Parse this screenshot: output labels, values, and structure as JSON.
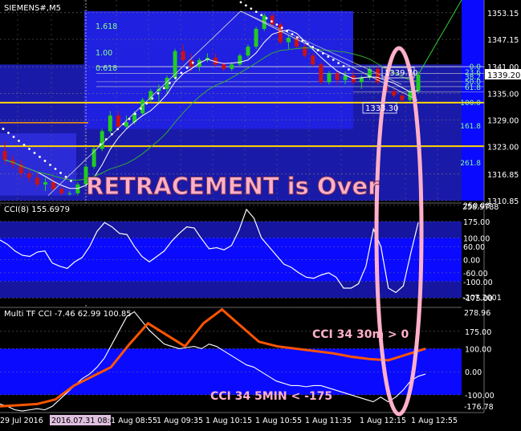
{
  "window": {
    "symbol_label": "SIEMENS#,M5"
  },
  "colors": {
    "bg": "#000000",
    "zone": "#1a1aa8",
    "zone_bright": "#0a0aff",
    "grid": "#555555",
    "candle_up": "#22cc22",
    "candle_down": "#cc1111",
    "ma_fast": "#ffffff",
    "ma_slow": "#33aa33",
    "psar": "#ffffff",
    "level_yellow": "#ffd700",
    "level_orange": "#ff9900",
    "fibo": "#88ff88",
    "pink": "#ffb0c8",
    "cci_line": "#ffffff",
    "cci30": "#ff5500"
  },
  "annotations": {
    "headline": "RETRACEMENT is Over",
    "cci30_note": "CCI 34 30m > 0",
    "cci5_note": "CCI 34 5MIN < -175"
  },
  "price_panel": {
    "last_price": "1339.20",
    "box_label_top": "1339.70",
    "box_label_bottom": "1333.30",
    "fibo_left": [
      "1.618",
      "1.00",
      "0.618"
    ],
    "fibo_right": [
      "0.0",
      "23.6",
      "38.2",
      "50.0",
      "61.8",
      "100.0",
      "161.8",
      "261.8"
    ]
  },
  "cci_panel": {
    "title": "CCI(8) 155.6979",
    "axis_top": "258.9788",
    "axis_bottom": "-207.2001"
  },
  "mtf_panel": {
    "title": "Multi TF CCI -7.46 62.99 100.85",
    "axis_top": "278.96",
    "axis_bottom": "-176.78"
  },
  "time_axis": {
    "labels": [
      "29 Jul 2016",
      "2016.07.31 08:40",
      "1 Aug 08:55",
      "1 Aug 09:35",
      "1 Aug 10:15",
      "1 Aug 10:55",
      "1 Aug 11:35",
      "1 Aug 12:15",
      "1 Aug 12:55"
    ]
  },
  "chart_data": [
    {
      "type": "candlestick",
      "title": "SIEMENS#,M5",
      "ylim": [
        1310.85,
        1356
      ],
      "yticks": [
        1353.15,
        1347.15,
        1341.0,
        1335.0,
        1329.0,
        1323.0,
        1316.85,
        1310.85
      ],
      "levels": {
        "yellow_upper": 1332.9,
        "yellow_lower": 1323.1,
        "orange": 1328.4
      },
      "candles": [
        [
          1322,
          1324,
          1319,
          1320
        ],
        [
          1320,
          1321,
          1318,
          1319
        ],
        [
          1319,
          1320,
          1316,
          1317
        ],
        [
          1317,
          1318,
          1315,
          1316
        ],
        [
          1316,
          1317,
          1314,
          1314.5
        ],
        [
          1314.5,
          1316,
          1313,
          1315
        ],
        [
          1315,
          1316,
          1313,
          1313.5
        ],
        [
          1313.5,
          1314,
          1312,
          1312.5
        ],
        [
          1312.5,
          1313,
          1312,
          1312.5
        ],
        [
          1312.5,
          1315,
          1312,
          1314.5
        ],
        [
          1314.5,
          1319,
          1314,
          1318.5
        ],
        [
          1318.5,
          1323,
          1318,
          1322.5
        ],
        [
          1322.5,
          1327,
          1322,
          1326.5
        ],
        [
          1326.5,
          1331,
          1326,
          1330
        ],
        [
          1330,
          1331,
          1327,
          1327.5
        ],
        [
          1327.5,
          1330,
          1327,
          1328.5
        ],
        [
          1328.5,
          1331,
          1328,
          1330.5
        ],
        [
          1330.5,
          1334,
          1330,
          1333.5
        ],
        [
          1333.5,
          1336,
          1333,
          1335.5
        ],
        [
          1335.5,
          1337,
          1333,
          1336
        ],
        [
          1336,
          1339,
          1335,
          1338.5
        ],
        [
          1338.5,
          1345,
          1338,
          1344.5
        ],
        [
          1344.5,
          1346,
          1342,
          1342.5
        ],
        [
          1342.5,
          1344,
          1340,
          1341
        ],
        [
          1341,
          1343,
          1340,
          1342.5
        ],
        [
          1342.5,
          1344,
          1342,
          1343
        ],
        [
          1343,
          1344,
          1341,
          1341.5
        ],
        [
          1341.5,
          1342,
          1340,
          1340.5
        ],
        [
          1340.5,
          1342,
          1340,
          1341.5
        ],
        [
          1341.5,
          1344,
          1341,
          1343.5
        ],
        [
          1343.5,
          1346,
          1343,
          1345.5
        ],
        [
          1345.5,
          1350,
          1345,
          1349.5
        ],
        [
          1349.5,
          1353,
          1349,
          1352.5
        ],
        [
          1352.5,
          1353,
          1350,
          1350.5
        ],
        [
          1350.5,
          1351,
          1346,
          1346.5
        ],
        [
          1346.5,
          1348,
          1345,
          1347.5
        ],
        [
          1347.5,
          1348,
          1345,
          1345.5
        ],
        [
          1345.5,
          1346,
          1343,
          1343.5
        ],
        [
          1343.5,
          1344,
          1341,
          1341.5
        ],
        [
          1341.5,
          1342,
          1337,
          1337.5
        ],
        [
          1337.5,
          1340,
          1337,
          1339.5
        ],
        [
          1339.5,
          1340,
          1337,
          1338
        ],
        [
          1338,
          1340,
          1337,
          1339
        ],
        [
          1339,
          1340,
          1337,
          1337.5
        ],
        [
          1337.5,
          1339,
          1336,
          1338.5
        ],
        [
          1338.5,
          1341,
          1338,
          1340.5
        ],
        [
          1340.5,
          1341,
          1337,
          1337.5
        ],
        [
          1337.5,
          1338,
          1335,
          1335.5
        ],
        [
          1335.5,
          1336,
          1334,
          1334.5
        ],
        [
          1334.5,
          1335,
          1333,
          1333.5
        ],
        [
          1333.5,
          1336,
          1333,
          1335.5
        ],
        [
          1335.5,
          1340,
          1335,
          1339.2
        ]
      ]
    },
    {
      "type": "line",
      "title": "CCI(8) 155.6979",
      "ylim": [
        -207.2001,
        258.9788
      ],
      "yticks": [
        250,
        175,
        100,
        60,
        0,
        -60,
        -100,
        -175
      ],
      "series": [
        {
          "name": "CCI(8)",
          "values": [
            90,
            70,
            40,
            20,
            15,
            35,
            40,
            -15,
            -30,
            -40,
            -10,
            10,
            60,
            130,
            170,
            150,
            120,
            115,
            60,
            15,
            -10,
            15,
            40,
            85,
            120,
            150,
            145,
            95,
            50,
            55,
            45,
            65,
            135,
            230,
            190,
            100,
            60,
            20,
            -20,
            -35,
            -60,
            -80,
            -85,
            -70,
            -60,
            -80,
            -130,
            -130,
            -110,
            -30,
            140,
            60,
            -130,
            -150,
            -120,
            30,
            170
          ]
        }
      ]
    },
    {
      "type": "line",
      "title": "Multi TF CCI -7.46 62.99 100.85",
      "ylim": [
        -176.78,
        278.96
      ],
      "yticks": [
        278.96,
        175,
        100,
        0,
        -100,
        -176.78
      ],
      "series": [
        {
          "name": "CCI 34 5MIN",
          "values": [
            -140,
            -150,
            -165,
            -170,
            -165,
            -160,
            -165,
            -150,
            -120,
            -90,
            -60,
            -30,
            -10,
            20,
            60,
            120,
            180,
            240,
            260,
            220,
            180,
            150,
            120,
            110,
            100,
            105,
            110,
            100,
            120,
            110,
            90,
            70,
            50,
            30,
            20,
            0,
            -20,
            -40,
            -50,
            -60,
            -60,
            -65,
            -60,
            -60,
            -70,
            -80,
            -90,
            -100,
            -110,
            -120,
            -130,
            -110,
            -130,
            -110,
            -80,
            -40,
            -20,
            -10
          ]
        },
        {
          "name": "CCI 34 30m",
          "values": [
            -150,
            -145,
            -140,
            -120,
            -60,
            -20,
            20,
            120,
            210,
            160,
            110,
            210,
            270,
            200,
            130,
            110,
            100,
            90,
            80,
            65,
            55,
            50,
            75,
            100
          ]
        }
      ]
    }
  ]
}
